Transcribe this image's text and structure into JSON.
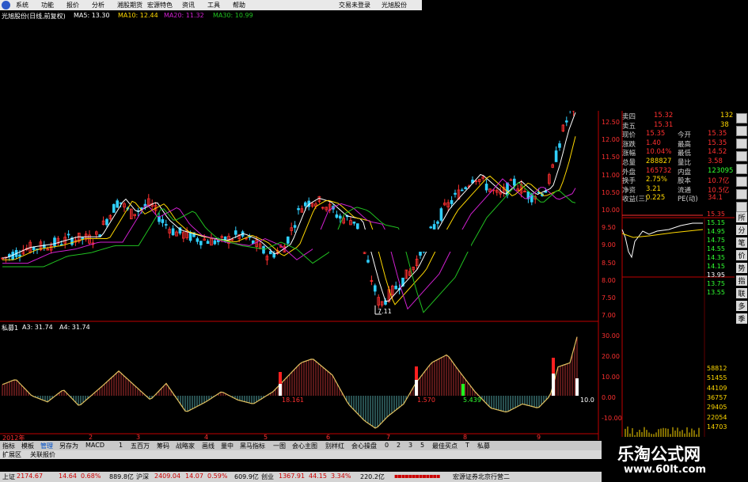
{
  "menu": {
    "items": [
      "系统",
      "功能",
      "报价",
      "分析",
      "湘股期货",
      "宏源特色",
      "资讯",
      "工具",
      "帮助"
    ],
    "right": [
      "交易未登录",
      "光旭股份"
    ]
  },
  "stock_header": {
    "name": "光旭股份(日线,前复权)",
    "ma5": "MA5: 13.30",
    "ma10": "MA10: 12.44",
    "ma20": "MA20: 11.32",
    "ma30": "MA30: 10.99"
  },
  "indicator_header": {
    "name": "私募1",
    "a3": "A3: 31.74",
    "a4": "A4: 31.74"
  },
  "price_axis": [
    "12.50",
    "12.00",
    "11.50",
    "11.00",
    "10.50",
    "10.00",
    "9.50",
    "9.00",
    "8.50",
    "8.00",
    "7.50",
    "7.00"
  ],
  "indicator_axis": [
    "30.00",
    "20.00",
    "10.00",
    "0.00",
    "-10.00"
  ],
  "chart_labels": {
    "low_price": "7.11",
    "val1": "18.161",
    "val2": "1.570",
    "val3": "5.439",
    "val4": "10.0",
    "month_labels": [
      "2012年",
      "2",
      "3",
      "4",
      "5",
      "6",
      "7",
      "8",
      "9"
    ]
  },
  "quote": {
    "rows": [
      {
        "label": "卖四",
        "value": "15.32",
        "extra": "132"
      },
      {
        "label": "卖五",
        "value": "15.31",
        "extra": "38"
      },
      {
        "label": "现价",
        "value": "15.35",
        "label2": "今开",
        "value2": "15.35"
      },
      {
        "label": "涨跌",
        "value": "1.40",
        "label2": "最高",
        "value2": "15.35"
      },
      {
        "label": "涨幅",
        "value": "10.04%",
        "label2": "最低",
        "value2": "14.52"
      },
      {
        "label": "总量",
        "value": "288827",
        "label2": "量比",
        "value2": "3.58"
      },
      {
        "label": "外盘",
        "value": "165732",
        "label2": "内盘",
        "value2": "123095"
      },
      {
        "label": "换手",
        "value": "2.75%",
        "label2": "股本",
        "value2": "10.7亿"
      },
      {
        "label": "净资",
        "value": "3.21",
        "label2": "流通",
        "value2": "10.5亿"
      },
      {
        "label": "收益(三)",
        "value": "0.225",
        "label2": "PE(动)",
        "value2": "34.1"
      }
    ]
  },
  "mini_axis": [
    "15.35",
    "15.15",
    "14.95",
    "14.75",
    "14.55",
    "14.35",
    "14.15",
    "13.95",
    "13.75",
    "13.55"
  ],
  "volume_axis": [
    "58812",
    "51455",
    "44109",
    "36757",
    "29405",
    "22054",
    "14703"
  ],
  "right_toolbar": [
    "所",
    "分",
    "笔",
    "价",
    "势",
    "指",
    "联",
    "多",
    "季"
  ],
  "bottom_tabs": [
    "指标",
    "模板",
    "管理",
    "另存为",
    "MACD",
    "1",
    "五百万",
    "筹码",
    "战略家",
    "画线",
    "量中",
    "黑马指标",
    "一图",
    "会心主图",
    "别样红",
    "会心操盘",
    "0",
    "2",
    "3",
    "5",
    "最佳买点",
    "T",
    "私募"
  ],
  "ext_tabs": [
    "扩展区",
    "关联报价"
  ],
  "status": {
    "sh_label": "上证",
    "sh_val": "2174.67",
    "sh_chg": "14.64",
    "sh_pct": "0.68%",
    "sh_amt": "889.8亿",
    "sz_label": "沪深",
    "sz_val": "2409.04",
    "sz_chg": "14.07",
    "sz_pct": "0.59%",
    "sz_amt": "609.9亿",
    "cy_label": "创业",
    "cy_val": "1367.91",
    "cy_chg": "44.15",
    "cy_pct": "3.34%",
    "cy_amt": "220.2亿",
    "broker": "宏源证券北京行营二"
  },
  "watermark": {
    "line1": "乐淘公式网",
    "line2": "www.60lt.com"
  },
  "colors": {
    "up": "#ff3030",
    "down": "#30d0ff",
    "ma5": "#ffffff",
    "ma10": "#ffd800",
    "ma20": "#d020d0",
    "ma30": "#20c020"
  }
}
